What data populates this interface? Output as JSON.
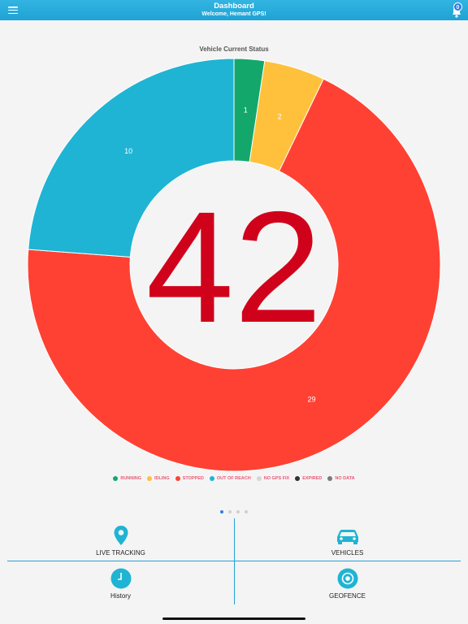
{
  "header": {
    "title": "Dashboard",
    "subtitle": "Welcome, Hemant GPS!",
    "notification_count": "0"
  },
  "chart_data": {
    "type": "pie",
    "title": "Vehicle Current Status",
    "center_value": "42",
    "slices": [
      {
        "label": "RUNNING",
        "value": 1,
        "color": "#14a76c"
      },
      {
        "label": "IDLING",
        "value": 2,
        "color": "#ffc13b"
      },
      {
        "label": "STOPPED",
        "value": 29,
        "color": "#ff4133"
      },
      {
        "label": "OUT OF REACH",
        "value": 10,
        "color": "#1fb4d4"
      }
    ],
    "legend": [
      {
        "label": "RUNNING",
        "color": "#14a76c"
      },
      {
        "label": "IDLING",
        "color": "#ffc13b"
      },
      {
        "label": "STOPPED",
        "color": "#ff4133"
      },
      {
        "label": "OUT OF REACH",
        "color": "#1fb4d4"
      },
      {
        "label": "NO GPS FIX",
        "color": "#d6d6d6"
      },
      {
        "label": "EXPIRED",
        "color": "#333333"
      },
      {
        "label": "NO DATA",
        "color": "#7a7a7a"
      }
    ],
    "legend_placement": "bottom",
    "center_color": "#d0021b"
  },
  "pager": {
    "count": 4,
    "active": 0
  },
  "tiles": {
    "live_tracking": "LIVE TRACKING",
    "vehicles": "VEHICLES",
    "history": "History",
    "geofence": "GEOFENCE"
  },
  "colors": {
    "accent": "#1fa3d4",
    "icon": "#1fb4d4"
  }
}
